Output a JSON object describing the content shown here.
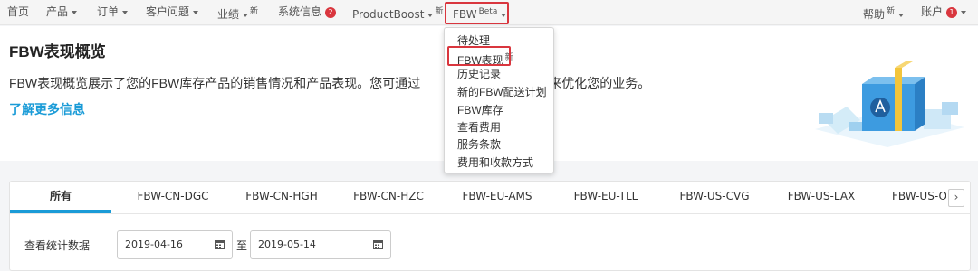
{
  "nav": {
    "items": [
      {
        "label": "首页"
      },
      {
        "label": "产品"
      },
      {
        "label": "订单"
      },
      {
        "label": "客户问题"
      },
      {
        "label": "业绩"
      },
      {
        "label": "系统信息"
      },
      {
        "label": "ProductBoost"
      },
      {
        "label": "FBW"
      },
      {
        "label": "帮助"
      },
      {
        "label": "账户"
      }
    ],
    "new_tag": "新",
    "beta_tag": "Beta",
    "system_badge": "2",
    "account_badge": "1"
  },
  "fbw_menu": {
    "items": [
      {
        "label": "待处理"
      },
      {
        "label": "FBW表现",
        "tag": "新"
      },
      {
        "label": "历史记录"
      },
      {
        "label": "新的FBW配送计划"
      },
      {
        "label": "FBW库存"
      },
      {
        "label": "查看费用"
      },
      {
        "label": "服务条款"
      },
      {
        "label": "费用和收款方式"
      }
    ]
  },
  "page": {
    "title": "FBW表现概览",
    "description": "FBW表现概览展示了您的FBW库存产品的销售情况和产品表现。您可通过",
    "description_tail": "货来优化您的业务。",
    "learn_more": "了解更多信息"
  },
  "tabs": [
    {
      "label": "所有"
    },
    {
      "label": "FBW-CN-DGC"
    },
    {
      "label": "FBW-CN-HGH"
    },
    {
      "label": "FBW-CN-HZC"
    },
    {
      "label": "FBW-EU-AMS"
    },
    {
      "label": "FBW-EU-TLL"
    },
    {
      "label": "FBW-US-CVG"
    },
    {
      "label": "FBW-US-LAX"
    },
    {
      "label": "FBW-US-OR"
    }
  ],
  "tab_next_glyph": "›",
  "filters": {
    "label": "查看统计数据",
    "start_date": "2019-04-16",
    "separator": "至",
    "end_date": "2019-05-14"
  },
  "colors": {
    "accent": "#1a9bd7",
    "highlight_border": "#d9363e"
  }
}
